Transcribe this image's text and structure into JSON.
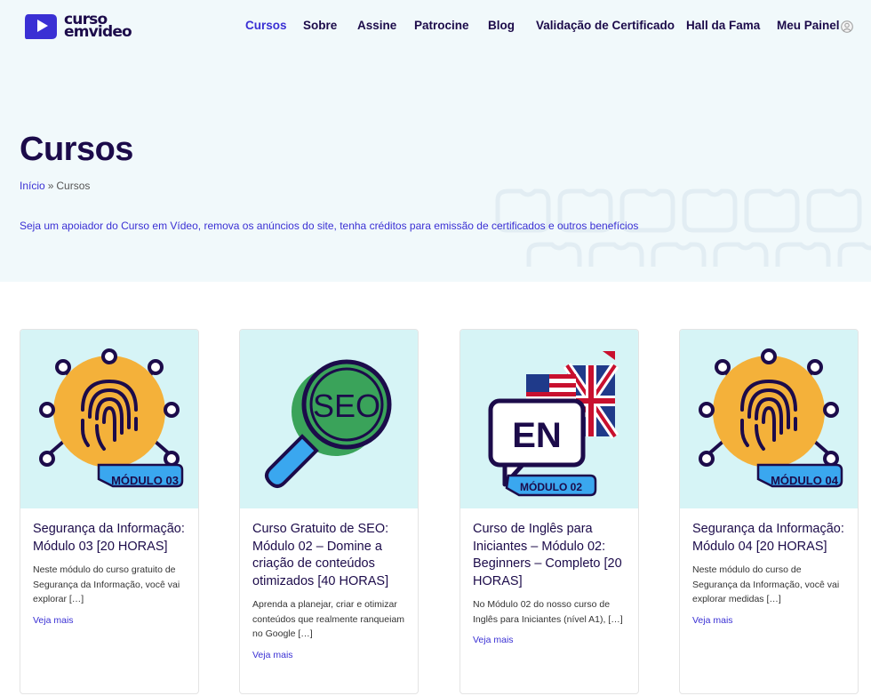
{
  "header": {
    "logo": {
      "line1": "curso",
      "line2": "emvideo"
    },
    "nav": [
      {
        "label": "Cursos",
        "active": true
      },
      {
        "label": "Sobre"
      },
      {
        "label": "Assine"
      },
      {
        "label": "Patrocine"
      },
      {
        "label": "Blog"
      },
      {
        "label": "Validação de Certificado"
      },
      {
        "label": "Hall da Fama"
      },
      {
        "label": "Meu Painel"
      }
    ],
    "user_icon": "user-avatar-icon"
  },
  "hero": {
    "title": "Cursos",
    "breadcrumb": {
      "home": "Início",
      "separator": "»",
      "current": "Cursos"
    },
    "promo": "Seja um apoiador do Curso em Vídeo, remova os anúncios do site, tenha créditos para emissão de certificados e outros benefícios"
  },
  "cards": [
    {
      "badge": "MÓDULO 03",
      "image": "fingerprint-icon",
      "title": "Segurança da Informação: Módulo 03 [20 HORAS]",
      "excerpt": "Neste módulo do curso gratuito de Segurança da Informação, você vai explorar […]",
      "more": "Veja mais"
    },
    {
      "badge": "",
      "image": "seo-magnifier-icon",
      "image_text": "SEO",
      "title": "Curso Gratuito de SEO: Módulo 02 – Domine a criação de conteúdos otimizados [40 HORAS]",
      "excerpt": "Aprenda a planejar, criar e otimizar conteúdos que realmente ranqueiam no Google […]",
      "more": "Veja mais"
    },
    {
      "badge": "MÓDULO 02",
      "image": "english-speech-bubble-icon",
      "image_text": "EN",
      "title": "Curso de Inglês para Iniciantes – Módulo 02: Beginners – Completo [20 HORAS]",
      "excerpt": "No Módulo 02 do nosso curso de Inglês para Iniciantes (nível A1), […]",
      "more": "Veja mais"
    },
    {
      "badge": "MÓDULO 04",
      "image": "fingerprint-icon",
      "title": "Segurança da Informação: Módulo 04 [20 HORAS]",
      "excerpt": "Neste módulo do curso de Segurança da Informação, você vai explorar medidas […]",
      "more": "Veja mais"
    }
  ],
  "colors": {
    "brand_blue": "#3a30d4",
    "navy": "#1c0b4a",
    "hero_bg": "#f1f9fb",
    "card_image_bg": "#d6f4f6",
    "badge_blue": "#3aa7ef",
    "orange": "#f4b13a",
    "green": "#3aa35a"
  }
}
